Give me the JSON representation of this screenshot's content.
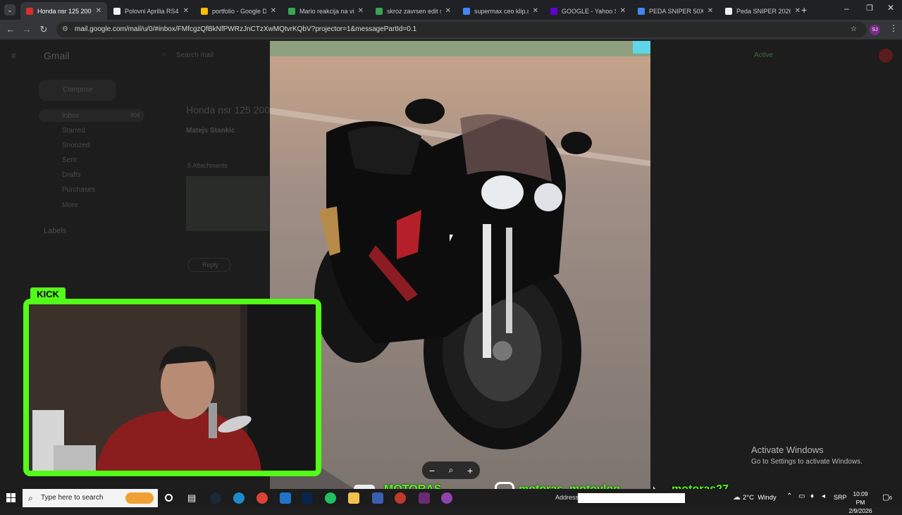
{
  "browser": {
    "tabs": [
      {
        "title": "Honda nsr 125 2001",
        "color": "#d93025",
        "active": true
      },
      {
        "title": "Polovni Aprilia RS4 5",
        "color": "#f1f1f1",
        "active": false
      },
      {
        "title": "portfolio - Google D",
        "color": "#fbbc04",
        "active": false
      },
      {
        "title": "Mario reakcija na vid",
        "color": "#34a853",
        "active": false
      },
      {
        "title": "skroz zavrsen edit stu",
        "color": "#34a853",
        "active": false
      },
      {
        "title": "supermax ceo klip.m",
        "color": "#4285f4",
        "active": false
      },
      {
        "title": "GOOGLE - Yahoo Sea",
        "color": "#6001d2",
        "active": false
      },
      {
        "title": "PEDA SNIPER 50X - G",
        "color": "#4285f4",
        "active": false
      },
      {
        "title": "Peda SNIPER 2026.g",
        "color": "#f1f1f1",
        "active": false
      }
    ],
    "url": "mail.google.com/mail/u/0/#inbox/FMfcgzQfBkNfPWRzJnCTzXwMQtvrKQbV?projector=1&messagePartId=0.1",
    "profile": "SJ"
  },
  "gmail_background": {
    "logo": "Gmail",
    "search_placeholder": "Search mail",
    "compose": "Compose",
    "sidebar": [
      "Inbox",
      "Starred",
      "Snoozed",
      "Sent",
      "Drafts",
      "Purchases",
      "More"
    ],
    "inbox_count": "904",
    "labels": "Labels",
    "subject": "Honda nsr 125 2001",
    "sender": "Matejs Stankic",
    "attachments": "5 Attachments",
    "reply": "Reply",
    "status": "Active"
  },
  "stream_overlay": {
    "platform_badge": "KICK",
    "youtube_handle": "MOTORAS",
    "instagram_handle": "motoras_motovlog",
    "tiktok_handle": "motoras27",
    "brand_color": "#53fc18"
  },
  "watermark": {
    "title": "Activate Windows",
    "subtitle": "Go to Settings to activate Windows."
  },
  "taskbar": {
    "search_placeholder": "Type here to search",
    "address_label": "Address",
    "weather": "2°C  Windy",
    "language": "SRP",
    "time": "10:09 PM",
    "date": "2/9/2026",
    "notifications": "6"
  }
}
